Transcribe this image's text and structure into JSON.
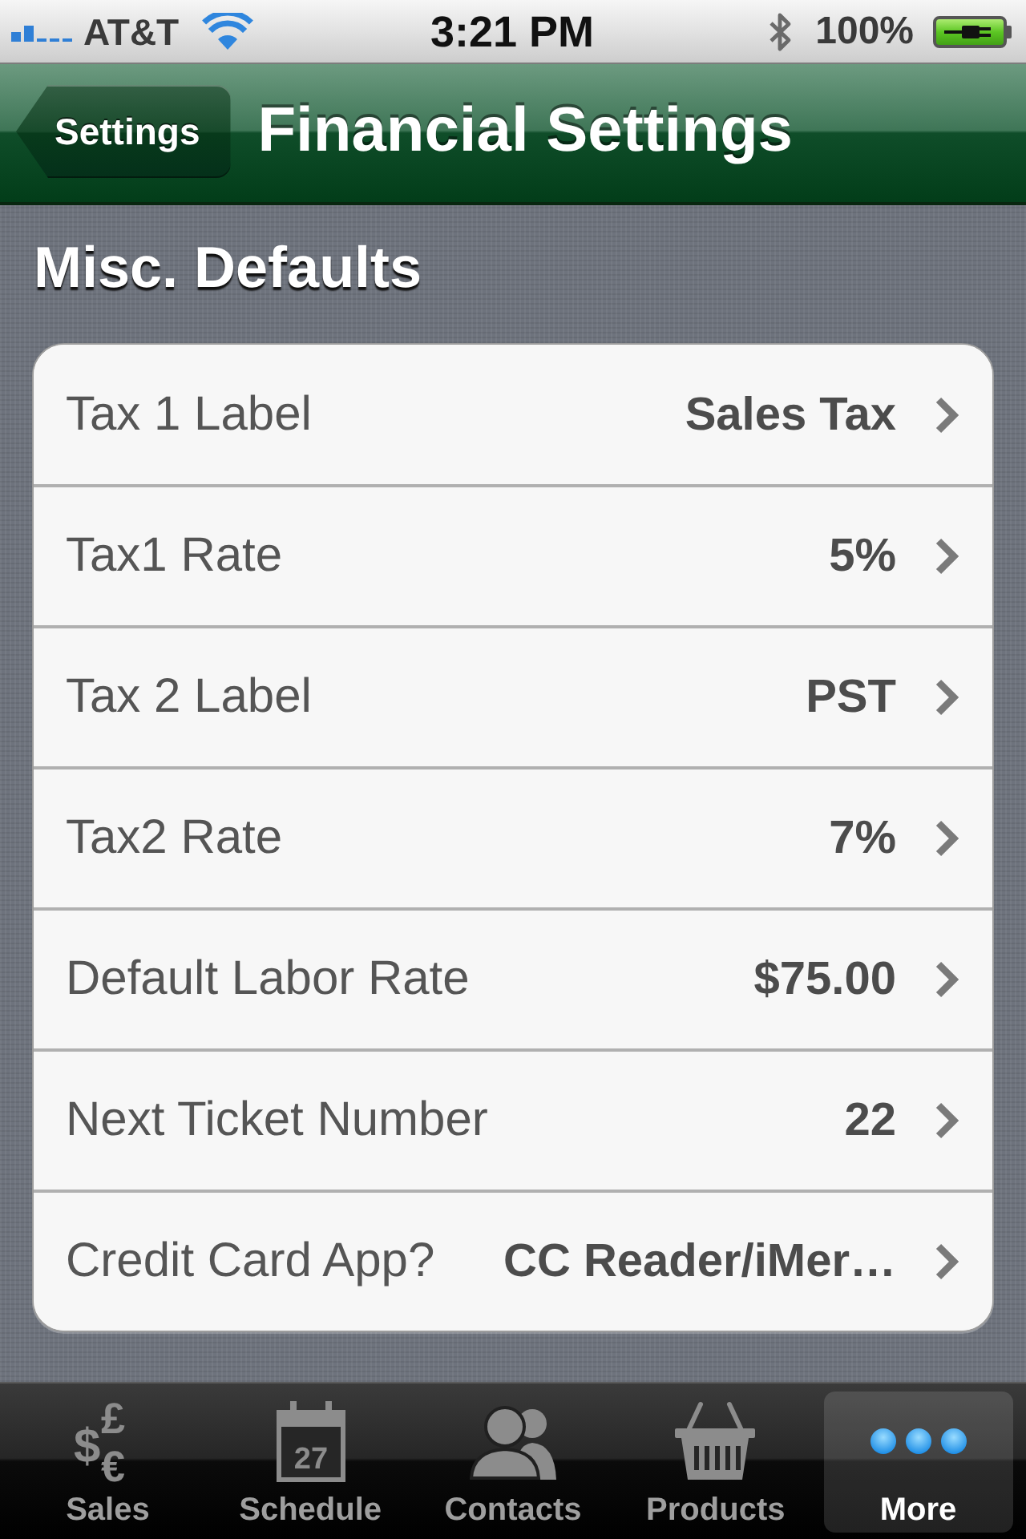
{
  "status_bar": {
    "carrier": "AT&T",
    "time": "3:21 PM",
    "battery_percent": "100%"
  },
  "nav_bar": {
    "back_button": "Settings",
    "title": "Financial Settings"
  },
  "section": {
    "title": "Misc. Defaults",
    "rows": [
      {
        "label": "Tax 1 Label",
        "value": "Sales Tax"
      },
      {
        "label": "Tax1 Rate",
        "value": "5%"
      },
      {
        "label": "Tax 2 Label",
        "value": "PST"
      },
      {
        "label": "Tax2 Rate",
        "value": "7%"
      },
      {
        "label": "Default Labor Rate",
        "value": "$75.00"
      },
      {
        "label": "Next Ticket Number",
        "value": "22"
      },
      {
        "label": "Credit Card App?",
        "value": "CC Reader/iMer…"
      }
    ]
  },
  "tab_bar": {
    "tabs": [
      {
        "label": "Sales",
        "kind": "currency",
        "glyphs": [
          "$",
          "£",
          "€"
        ],
        "selected": false
      },
      {
        "label": "Schedule",
        "kind": "calendar",
        "day": "27",
        "selected": false
      },
      {
        "label": "Contacts",
        "kind": "people",
        "selected": false
      },
      {
        "label": "Products",
        "kind": "basket",
        "selected": false
      },
      {
        "label": "More",
        "kind": "more",
        "selected": true
      }
    ]
  }
}
